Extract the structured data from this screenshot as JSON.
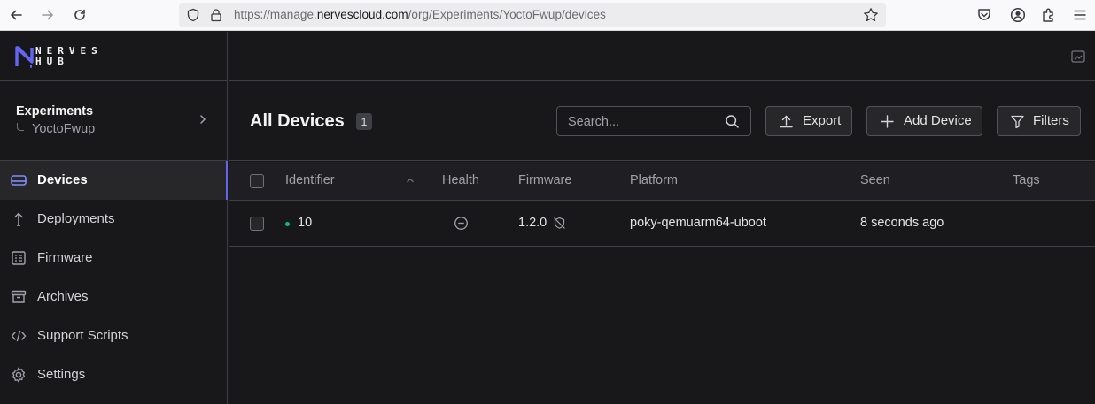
{
  "browser": {
    "url_prefix": "https://manage.",
    "url_domain": "nervescloud.com",
    "url_path": "/org/Experiments/YoctoFwup/devices"
  },
  "logo": {
    "line1": "NERVES",
    "line2": "HUB"
  },
  "org": {
    "name": "Experiments",
    "product": "YoctoFwup"
  },
  "sidebar": {
    "items": [
      {
        "label": "Devices",
        "icon": "devices-icon",
        "active": true
      },
      {
        "label": "Deployments",
        "icon": "deployments-icon",
        "active": false
      },
      {
        "label": "Firmware",
        "icon": "firmware-icon",
        "active": false
      },
      {
        "label": "Archives",
        "icon": "archive-icon",
        "active": false
      },
      {
        "label": "Support Scripts",
        "icon": "code-icon",
        "active": false
      },
      {
        "label": "Settings",
        "icon": "gear-icon",
        "active": false
      }
    ]
  },
  "header": {
    "title": "All Devices",
    "count": "1",
    "search_placeholder": "Search...",
    "export_label": "Export",
    "add_device_label": "Add Device",
    "filters_label": "Filters"
  },
  "table": {
    "columns": [
      "Identifier",
      "Health",
      "Firmware",
      "Platform",
      "Seen",
      "Tags"
    ],
    "rows": [
      {
        "identifier": "10",
        "status": "online",
        "health": "unknown",
        "firmware": "1.2.0",
        "platform": "poky-qemuarm64-uboot",
        "seen": "8 seconds ago",
        "tags": ""
      }
    ]
  },
  "colors": {
    "accent": "#6366f1",
    "online": "#10b981",
    "background": "#18181b"
  }
}
